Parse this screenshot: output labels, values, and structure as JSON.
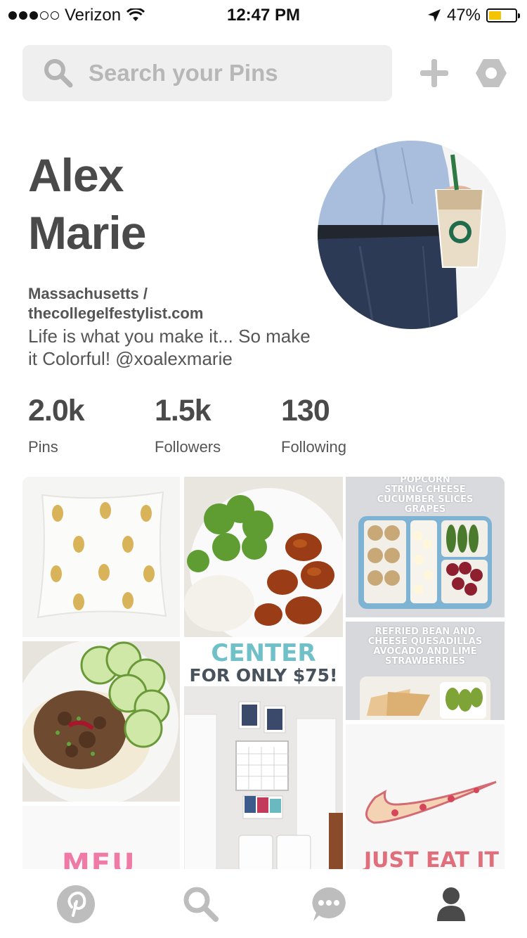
{
  "status_bar": {
    "carrier": "Verizon",
    "time": "12:47 PM",
    "battery": "47%",
    "battery_level": 0.47,
    "signal_bars_filled": 3,
    "signal_bars_total": 5
  },
  "header": {
    "search_placeholder": "Search your Pins",
    "icons": [
      "search-icon",
      "plus-icon",
      "settings-icon"
    ]
  },
  "profile": {
    "first_name": "Alex",
    "last_name": "Marie",
    "location": "Massachusetts /",
    "website": "thecollegelfestylist.com",
    "bio": "Life is what you make it... So make it Colorful! @xoalexmarie"
  },
  "stats": [
    {
      "value": "2.0k",
      "label": "Pins"
    },
    {
      "value": "1.5k",
      "label": "Followers"
    },
    {
      "value": "130",
      "label": "Following"
    }
  ],
  "pins": {
    "lunchbox1_text": [
      "POPCORN",
      "STRING CHEESE",
      "CUCUMBER SLICES",
      "GRAPES"
    ],
    "lunchbox2_text": [
      "REFRIED BEAN AND",
      "CHEESE QUESADILLAS",
      "AVOCADO AND LIME",
      "STRAWBERRIES"
    ],
    "command_center_line1": "CENTER",
    "command_center_line2": "FOR ONLY $75!",
    "nike_text": "JUST EAT IT",
    "pink_text": "MEU"
  },
  "bottom_nav": [
    "pinterest-home-icon",
    "search-icon",
    "messages-icon",
    "profile-icon"
  ],
  "colors": {
    "search_bg": "#efefef",
    "text_dark": "#4a4a4a",
    "icon_gray": "#bdbdbd",
    "profile_active": "#4a4a4a",
    "battery_yellow": "#f5c400"
  }
}
